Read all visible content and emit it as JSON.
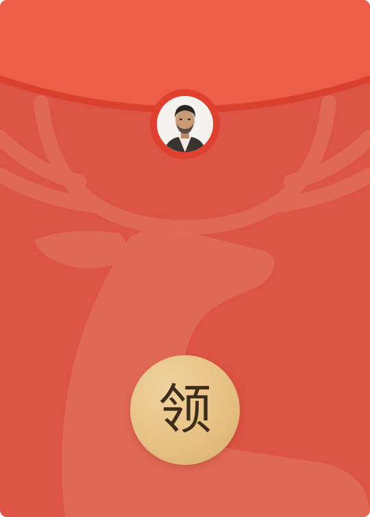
{
  "red_packet": {
    "sender_avatar": "sender-avatar-photo",
    "open_button_label": "领",
    "watermark": "deer-silhouette",
    "colors": {
      "envelope": "#dc5444",
      "flap": "#ec5e48",
      "flap_edge": "#d9402e",
      "avatar_ring": "#de4130",
      "button_gold": "#e6c184",
      "button_text": "#3d2d1a"
    }
  }
}
